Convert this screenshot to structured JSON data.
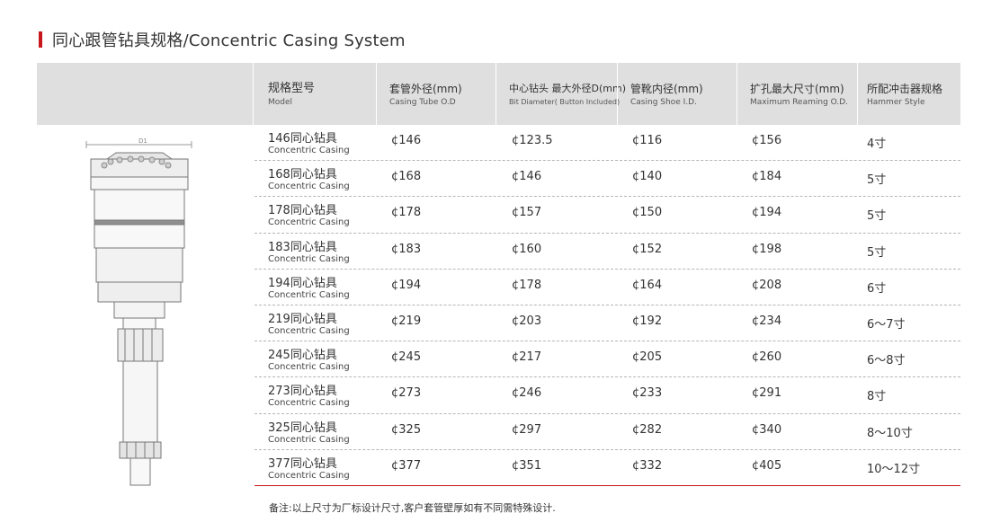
{
  "title": "同心跟管钻具规格/Concentric Casing System",
  "colors": {
    "accent": "#c8161d",
    "header_bg": "#dfdfdf"
  },
  "headers": [
    {
      "zh": "规格型号",
      "en": "Model"
    },
    {
      "zh": "套管外径(mm)",
      "en": "Casing Tube O.D"
    },
    {
      "zh": "中心钻头 最大外径D(mm)",
      "en": "Bit Diameter( Button Included)"
    },
    {
      "zh": "管靴内径(mm)",
      "en": "Casing Shoe I.D."
    },
    {
      "zh": "扩孔最大尺寸(mm)",
      "en": "Maximum Reaming O.D."
    },
    {
      "zh": "所配冲击器规格",
      "en": "Hammer Style"
    }
  ],
  "illustration": {
    "icon": "concentric-casing-drill-drawing",
    "label_d1": "D1"
  },
  "rows": [
    {
      "model_zh": "146同心钻具",
      "model_en": "Concentric Casing",
      "casing_od": "¢146",
      "bit_d": "¢123.5",
      "shoe_id": "¢116",
      "ream_od": "¢156",
      "hammer": "4寸"
    },
    {
      "model_zh": "168同心钻具",
      "model_en": "Concentric Casing",
      "casing_od": "¢168",
      "bit_d": "¢146",
      "shoe_id": "¢140",
      "ream_od": "¢184",
      "hammer": "5寸"
    },
    {
      "model_zh": "178同心钻具",
      "model_en": "Concentric Casing",
      "casing_od": "¢178",
      "bit_d": "¢157",
      "shoe_id": "¢150",
      "ream_od": "¢194",
      "hammer": "5寸"
    },
    {
      "model_zh": "183同心钻具",
      "model_en": "Concentric Casing",
      "casing_od": "¢183",
      "bit_d": "¢160",
      "shoe_id": "¢152",
      "ream_od": "¢198",
      "hammer": "5寸"
    },
    {
      "model_zh": "194同心钻具",
      "model_en": "Concentric Casing",
      "casing_od": "¢194",
      "bit_d": "¢178",
      "shoe_id": "¢164",
      "ream_od": "¢208",
      "hammer": "6寸"
    },
    {
      "model_zh": "219同心钻具",
      "model_en": "Concentric Casing",
      "casing_od": "¢219",
      "bit_d": "¢203",
      "shoe_id": "¢192",
      "ream_od": "¢234",
      "hammer": "6～7寸"
    },
    {
      "model_zh": "245同心钻具",
      "model_en": "Concentric Casing",
      "casing_od": "¢245",
      "bit_d": "¢217",
      "shoe_id": "¢205",
      "ream_od": "¢260",
      "hammer": "6～8寸"
    },
    {
      "model_zh": "273同心钻具",
      "model_en": "Concentric Casing",
      "casing_od": "¢273",
      "bit_d": "¢246",
      "shoe_id": "¢233",
      "ream_od": "¢291",
      "hammer": "8寸"
    },
    {
      "model_zh": "325同心钻具",
      "model_en": "Concentric Casing",
      "casing_od": "¢325",
      "bit_d": "¢297",
      "shoe_id": "¢282",
      "ream_od": "¢340",
      "hammer": "8～10寸"
    },
    {
      "model_zh": "377同心钻具",
      "model_en": "Concentric Casing",
      "casing_od": "¢377",
      "bit_d": "¢351",
      "shoe_id": "¢332",
      "ream_od": "¢405",
      "hammer": "10～12寸"
    }
  ],
  "note": "备注:以上尺寸为厂标设计尺寸,客户套管壁厚如有不同需特殊设计."
}
